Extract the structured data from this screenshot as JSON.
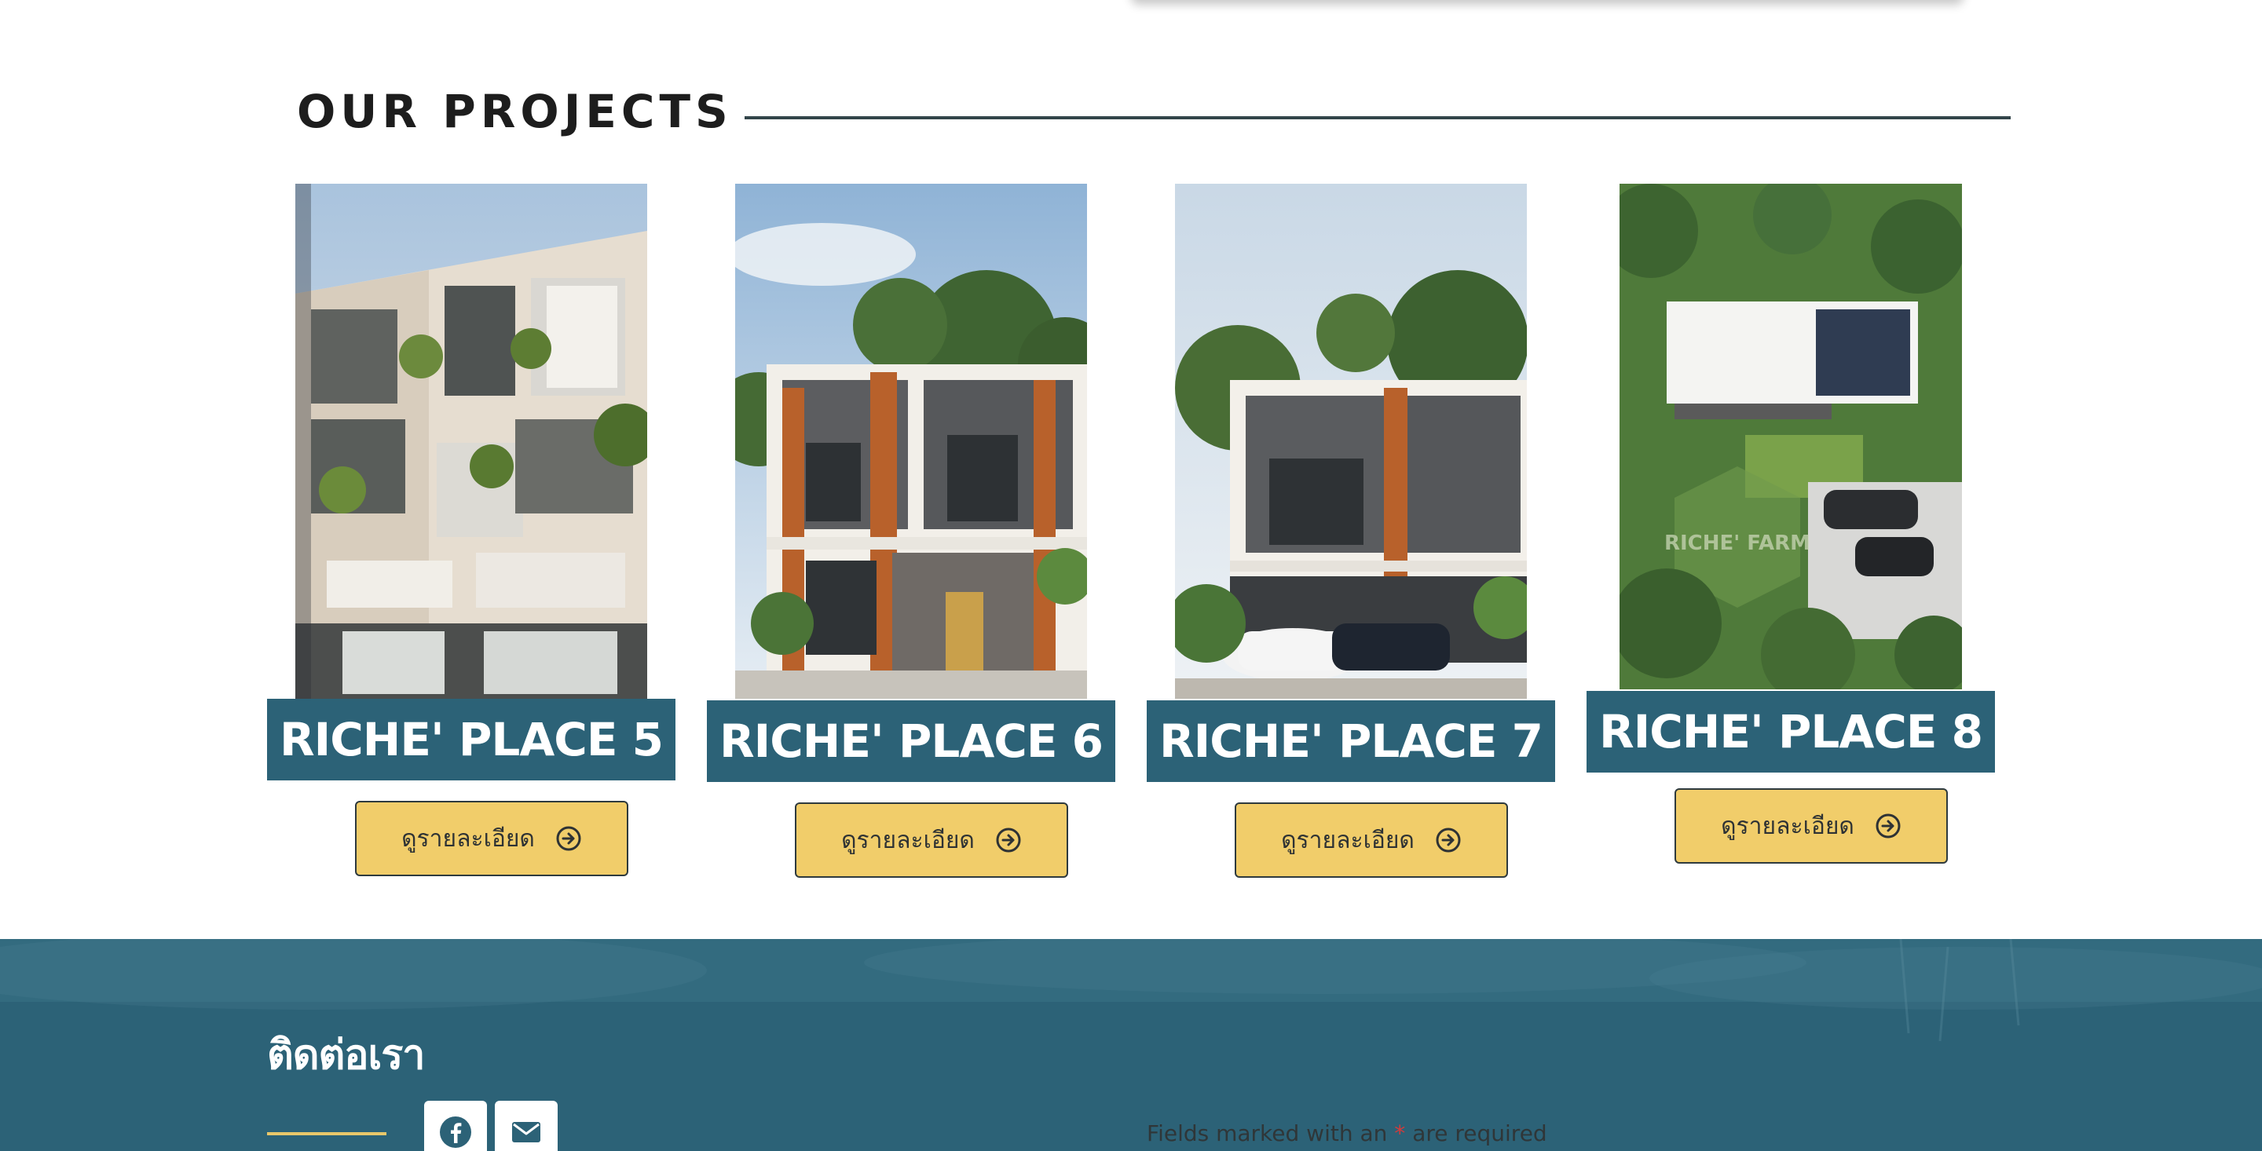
{
  "section": {
    "title": "OUR PROJECTS"
  },
  "projects": [
    {
      "name": "RICHE' PLACE 5",
      "button_label": "ดูรายละเอียด",
      "button_icon": "arrow-circle-right-icon"
    },
    {
      "name": "RICHE' PLACE 6",
      "button_label": "ดูรายละเอียด",
      "button_icon": "arrow-circle-right-icon"
    },
    {
      "name": "RICHE' PLACE 7",
      "button_label": "ดูรายละเอียด",
      "button_icon": "arrow-circle-right-icon"
    },
    {
      "name": "RICHE' PLACE 8",
      "button_label": "ดูรายละเอียด",
      "button_icon": "arrow-circle-right-icon",
      "image_watermark": "RICHE' FARM"
    }
  ],
  "footer": {
    "title": "ติดต่อเรา",
    "social": [
      {
        "icon": "facebook-icon"
      },
      {
        "icon": "envelope-icon"
      }
    ],
    "form_note": {
      "before": "Fields marked with an",
      "star": "*",
      "after": "are required"
    }
  },
  "colors": {
    "banner": "#2c6277",
    "button": "#f1cd6a",
    "footer": "#2c6277",
    "accent_rule": "#e9c76a",
    "required_star": "#d23b3b"
  }
}
